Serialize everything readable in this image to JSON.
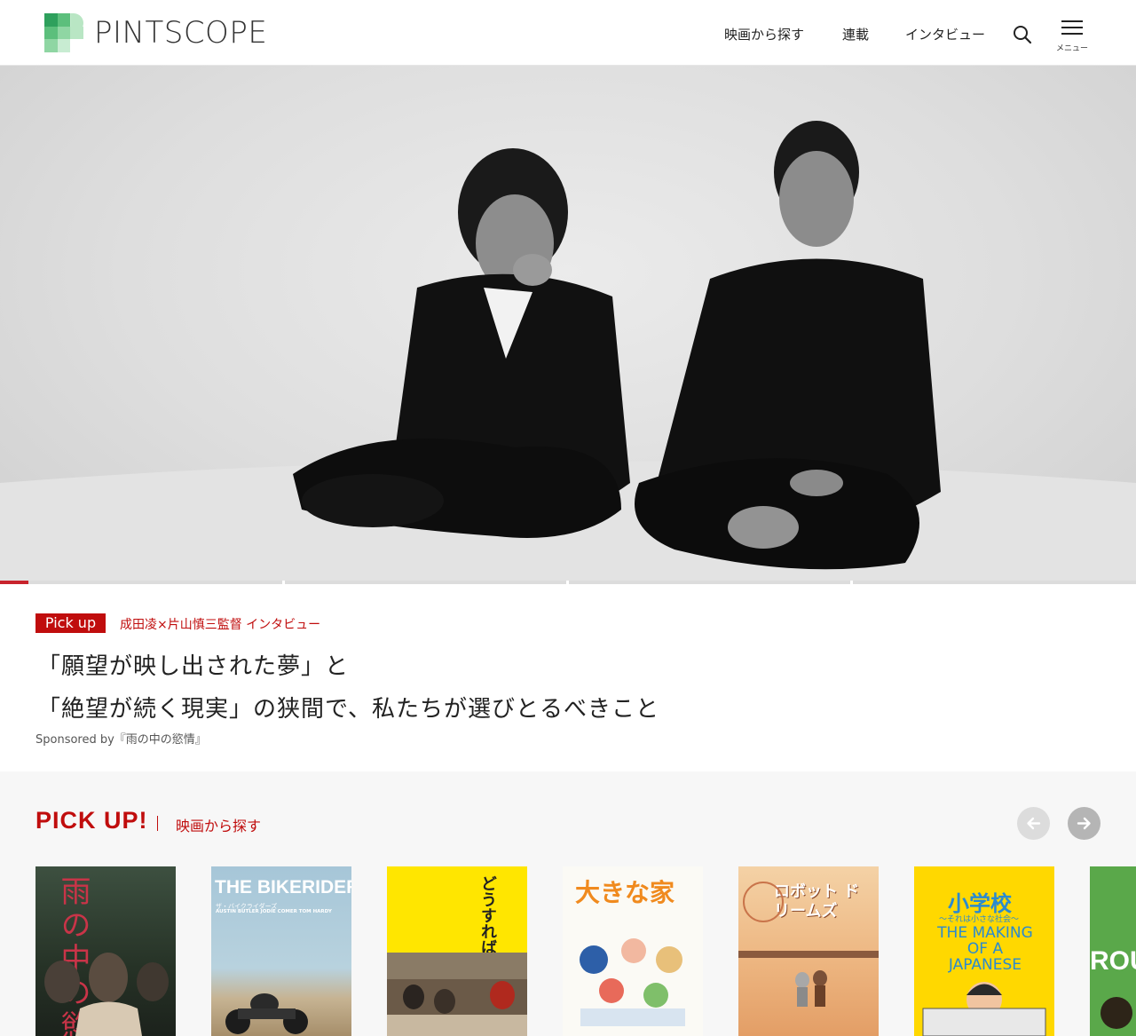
{
  "header": {
    "logo_text": "PINTSCOPE",
    "nav": [
      {
        "label": "映画から探す"
      },
      {
        "label": "連載"
      },
      {
        "label": "インタビュー"
      }
    ],
    "menu_label": "メニュー",
    "icons": [
      "search-icon",
      "menu-icon"
    ]
  },
  "hero": {
    "slide_count": 4,
    "current_slide": 1,
    "slide_progress": 0.1
  },
  "pickup_article": {
    "badge": "Pick up",
    "subtitle": "成田凌×片山慎三監督 インタビュー",
    "headline_lines": [
      "「願望が映し出された夢」と",
      "「絶望が続く現実」の狭間で、私たちが選びとるべきこと"
    ],
    "sponsored": "Sponsored by『雨の中の慾情』"
  },
  "pickup_section": {
    "title": "PICK UP!",
    "link": "映画から探す",
    "prev_icon": "arrow-left-icon",
    "next_icon": "arrow-right-icon",
    "posters": [
      {
        "name": "雨の中の慾情",
        "text": "雨の中の慾情",
        "color": "#2e3b2c"
      },
      {
        "name": "THE BIKERIDERS",
        "title": "THE BIKERIDERS",
        "jp": "ザ・バイクライダーズ",
        "cast": "AUSTIN BUTLER   JODIE COMER   TOM HARDY",
        "color": "#9fc2d4"
      },
      {
        "name": "どうすればよかったか？",
        "text": "どうすれば よかったか？",
        "color": "#ffe600"
      },
      {
        "name": "大きな家",
        "text": "大きな家",
        "color": "#fbfaf5"
      },
      {
        "name": "ロボット・ドリームズ",
        "text": "ロボット ドリームズ",
        "color": "#e8b27c"
      },
      {
        "name": "小学校 THE MAKING OF A JAPANESE",
        "title": "小学校",
        "sub": "〜それは小さな社会〜",
        "en": "THE MAKING OF A JAPANESE",
        "color": "#ffd800"
      },
      {
        "name": "partial-poster",
        "text": "ROU",
        "color": "#5aa84a"
      }
    ]
  },
  "colors": {
    "accent": "#c00d0d",
    "progress": "#c8232c",
    "section_bg": "#f7f7f7"
  }
}
